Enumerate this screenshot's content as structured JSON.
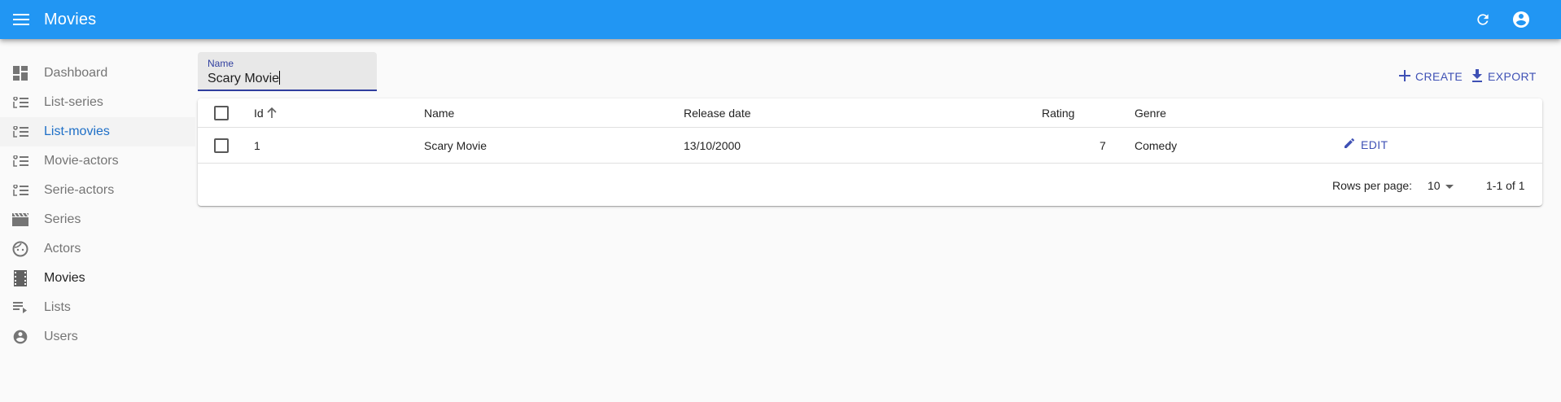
{
  "app": {
    "title": "Movies",
    "accent": "#2196f3"
  },
  "sidebar": {
    "items": [
      {
        "label": "Dashboard",
        "icon": "dashboard-icon"
      },
      {
        "label": "List-series",
        "icon": "list-icon"
      },
      {
        "label": "List-movies",
        "icon": "list-icon"
      },
      {
        "label": "Movie-actors",
        "icon": "list-icon"
      },
      {
        "label": "Serie-actors",
        "icon": "list-icon"
      },
      {
        "label": "Series",
        "icon": "movie-clapper-icon"
      },
      {
        "label": "Actors",
        "icon": "face-icon"
      },
      {
        "label": "Movies",
        "icon": "film-strip-icon"
      },
      {
        "label": "Lists",
        "icon": "playlist-icon"
      },
      {
        "label": "Users",
        "icon": "account-circle-icon"
      }
    ]
  },
  "filter": {
    "label": "Name",
    "value": "Scary Movie"
  },
  "toolbar": {
    "create_label": "CREATE",
    "export_label": "EXPORT"
  },
  "table": {
    "columns": [
      "Id",
      "Name",
      "Release date",
      "Rating",
      "Genre"
    ],
    "rows": [
      {
        "id": "1",
        "name": "Scary Movie",
        "release_date": "13/10/2000",
        "rating": "7",
        "genre": "Comedy",
        "edit_label": "EDIT"
      }
    ]
  },
  "pagination": {
    "rows_per_page_label": "Rows per page:",
    "rows_per_page": "10",
    "range": "1-1 of 1"
  }
}
